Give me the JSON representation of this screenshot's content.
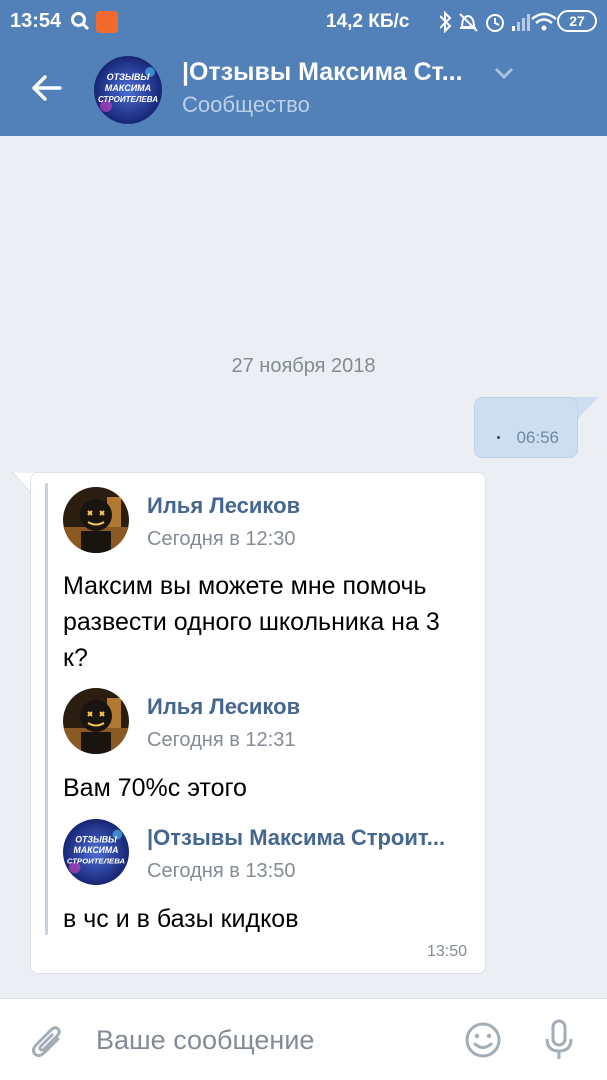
{
  "status_bar": {
    "time": "13:54",
    "speed": "14,2 КБ/с",
    "battery": "27"
  },
  "header": {
    "title": "|Отзывы Максима Ст...",
    "subtitle": "Сообщество",
    "avatar_text": [
      "ОТЗЫВЫ",
      "МАКСИМА",
      "СТРОИТЕЛЕВА"
    ]
  },
  "chat": {
    "date": "27 ноября 2018",
    "outgoing": {
      "time": "06:56"
    },
    "incoming": {
      "time": "13:50",
      "forwarded": [
        {
          "author": "Илья Лесиков",
          "date": "Сегодня в 12:30",
          "text": "Максим вы можете мне помочь развести одного школьника на 3 к?"
        },
        {
          "author": "Илья Лесиков",
          "date": "Сегодня в 12:31",
          "text": "Вам 70%с этого"
        },
        {
          "author": "|Отзывы Максима Строит...",
          "date": "Сегодня в 13:50",
          "text": "в чс и в базы кидков"
        }
      ]
    }
  },
  "input": {
    "placeholder": "Ваше сообщение"
  },
  "colors": {
    "header": "#5181b8",
    "background": "#ebeef2",
    "outgoing_bubble": "#ccdef0",
    "name": "#45678f"
  }
}
